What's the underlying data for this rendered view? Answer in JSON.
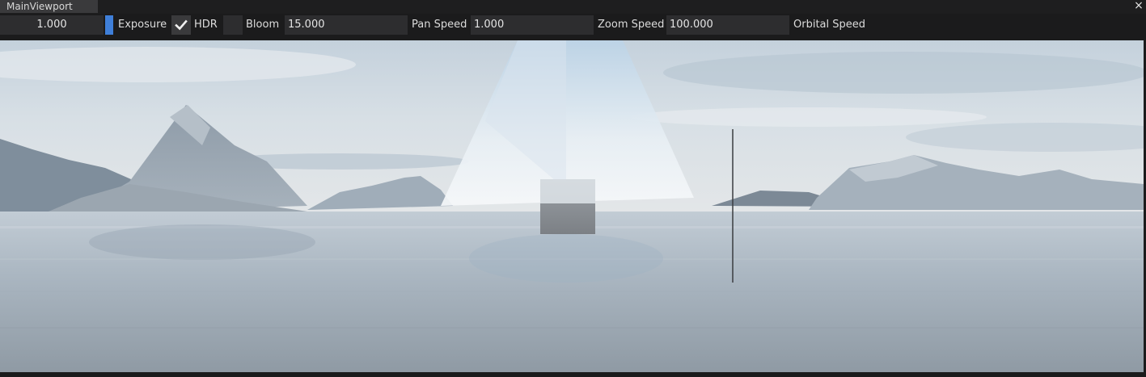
{
  "window": {
    "tab_title": "MainViewport",
    "close_icon": "×"
  },
  "toolbar": {
    "exposure_value": "1.000",
    "exposure_label": "Exposure",
    "hdr_checked": true,
    "hdr_label": "HDR",
    "bloom_label": "Bloom",
    "bloom_value": "15.000",
    "pan_speed_label": "Pan Speed",
    "pan_speed_value": "1.000",
    "zoom_speed_label": "Zoom Speed",
    "zoom_speed_value": "100.000",
    "orbital_speed_label": "Orbital Speed"
  },
  "colors": {
    "accent": "#3f7fd9",
    "panel": "#1b1b1c",
    "field": "#2d2d2f"
  }
}
